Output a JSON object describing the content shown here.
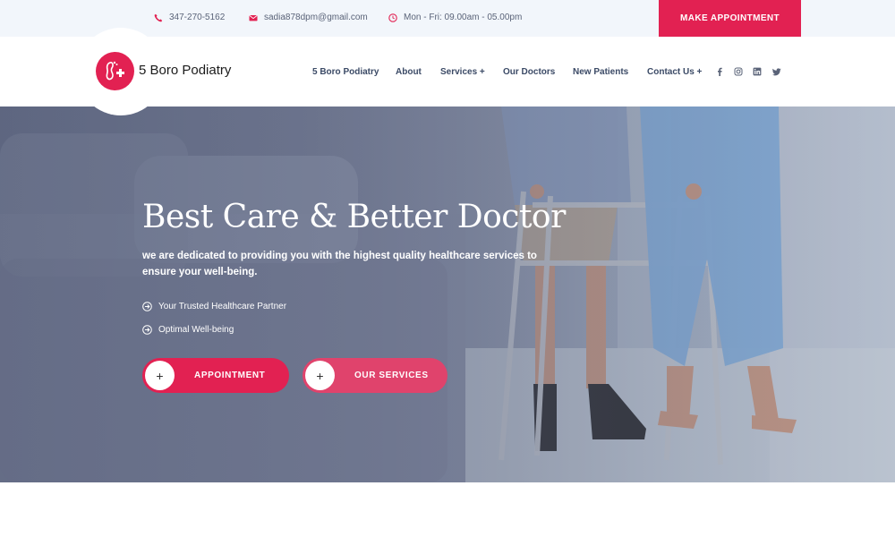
{
  "topbar": {
    "phone": "347-270-5162",
    "email": "sadia878dpm@gmail.com",
    "hours": "Mon - Fri: 09.00am - 05.00pm",
    "cta_label": "MAKE APPOINTMENT"
  },
  "brand": {
    "name": "5 Boro Podiatry",
    "accent": "#e22152"
  },
  "nav": {
    "items": [
      {
        "label": "5 Boro Podiatry"
      },
      {
        "label": "About"
      },
      {
        "label": "Services +"
      },
      {
        "label": "Our Doctors"
      },
      {
        "label": "New Patients"
      },
      {
        "label": "Contact Us +"
      }
    ],
    "social": [
      "facebook-icon",
      "instagram-icon",
      "linkedin-icon",
      "twitter-icon"
    ]
  },
  "hero": {
    "title": "Best Care & Better Doctor",
    "subtitle": "we are dedicated to providing you with the highest quality healthcare services to ensure your well-being.",
    "features": [
      {
        "label": "Your Trusted Healthcare Partner"
      },
      {
        "label": "Optimal Well-being"
      }
    ],
    "buttons": {
      "appointment": "APPOINTMENT",
      "services": "OUR SERVICES",
      "plus": "+"
    }
  }
}
